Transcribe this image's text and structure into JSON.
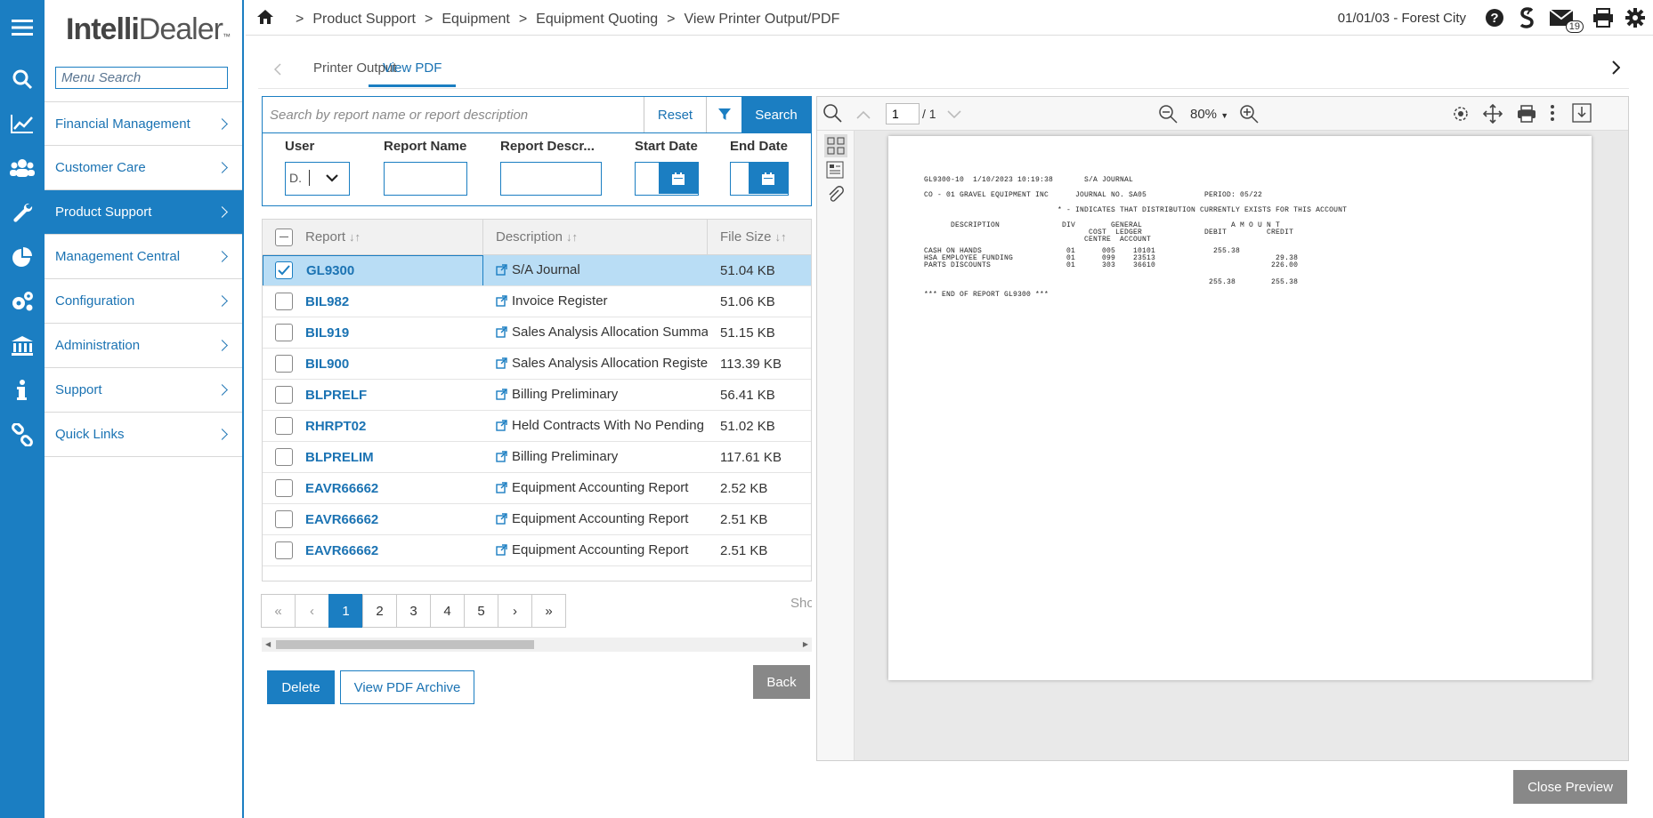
{
  "app": {
    "logo_main": "Intelli",
    "logo_sub": "Dealer",
    "logo_tm": "™"
  },
  "sidebar": {
    "search_placeholder": "Menu Search",
    "items": [
      {
        "label": "Financial Management",
        "icon": "chart-line-icon"
      },
      {
        "label": "Customer Care",
        "icon": "users-icon"
      },
      {
        "label": "Product Support",
        "icon": "wrench-icon",
        "active": true
      },
      {
        "label": "Management Central",
        "icon": "pie-chart-icon"
      },
      {
        "label": "Configuration",
        "icon": "gears-icon"
      },
      {
        "label": "Administration",
        "icon": "bank-icon"
      },
      {
        "label": "Support",
        "icon": "info-icon"
      },
      {
        "label": "Quick Links",
        "icon": "link-icon"
      }
    ]
  },
  "breadcrumb": [
    "Product Support",
    "Equipment",
    "Equipment Quoting",
    "View Printer Output/PDF"
  ],
  "header": {
    "location": "01/01/03 - Forest City",
    "mail_count": "19"
  },
  "tabs": [
    {
      "label": "Printer Output"
    },
    {
      "label": "View PDF",
      "active": true
    }
  ],
  "search": {
    "placeholder": "Search by report name or report description",
    "reset": "Reset",
    "search": "Search"
  },
  "filters": {
    "user": "User",
    "user_value": "D.",
    "report_name": "Report Name",
    "report_desc": "Report Descr...",
    "start_date": "Start Date",
    "end_date": "End Date"
  },
  "grid": {
    "columns": [
      "Report",
      "Description",
      "File Size"
    ],
    "rows": [
      {
        "report": "GL9300",
        "description": "S/A Journal",
        "size": "51.04 KB",
        "selected": true
      },
      {
        "report": "BIL982",
        "description": "Invoice Register",
        "size": "51.06 KB"
      },
      {
        "report": "BIL919",
        "description": "Sales Analysis Allocation Summa",
        "size": "51.15 KB"
      },
      {
        "report": "BIL900",
        "description": "Sales Analysis Allocation Registe",
        "size": "113.39 KB"
      },
      {
        "report": "BLPRELF",
        "description": "Billing Preliminary",
        "size": "56.41 KB"
      },
      {
        "report": "RHRPT02",
        "description": "Held Contracts With No Pending",
        "size": "51.02 KB"
      },
      {
        "report": "BLPRELIM",
        "description": "Billing Preliminary",
        "size": "117.61 KB"
      },
      {
        "report": "EAVR66662",
        "description": "Equipment Accounting Report",
        "size": "2.52 KB"
      },
      {
        "report": "EAVR66662",
        "description": "Equipment Accounting Report",
        "size": "2.51 KB"
      },
      {
        "report": "EAVR66662",
        "description": "Equipment Accounting Report",
        "size": "2.51 KB"
      }
    ]
  },
  "pager": {
    "first": "«",
    "prev": "‹",
    "pages": [
      "1",
      "2",
      "3",
      "4",
      "5"
    ],
    "next": "›",
    "last": "»",
    "shown": "Sho"
  },
  "buttons": {
    "delete": "Delete",
    "archive": "View PDF Archive",
    "back": "Back",
    "close_preview": "Close Preview"
  },
  "viewer": {
    "page": "1",
    "page_total": "/ 1",
    "zoom": "80%"
  },
  "pdf_lines": [
    "GL9300-10  1/10/2023 10:19:38       S/A JOURNAL",
    "CO - 01 GRAVEL EQUIPMENT INC      JOURNAL NO. SA05             PERIOD: 05/22",
    "                              * - INDICATES THAT DISTRIBUTION CURRENTLY EXISTS FOR THIS ACCOUNT",
    "      DESCRIPTION              DIV        GENERAL                    A M O U N T",
    "                                     COST  LEDGER              DEBIT         CREDIT",
    "                                    CENTRE  ACCOUNT",
    "CASH ON HANDS                   01      005    10101             255.38",
    "HSA EMPLOYEE FUNDING            01      099    23513                           29.38",
    "PARTS DISCOUNTS                 01      303    36610                          226.00",
    "                                                                255.38        255.38",
    "*** END OF REPORT GL9300 ***"
  ]
}
